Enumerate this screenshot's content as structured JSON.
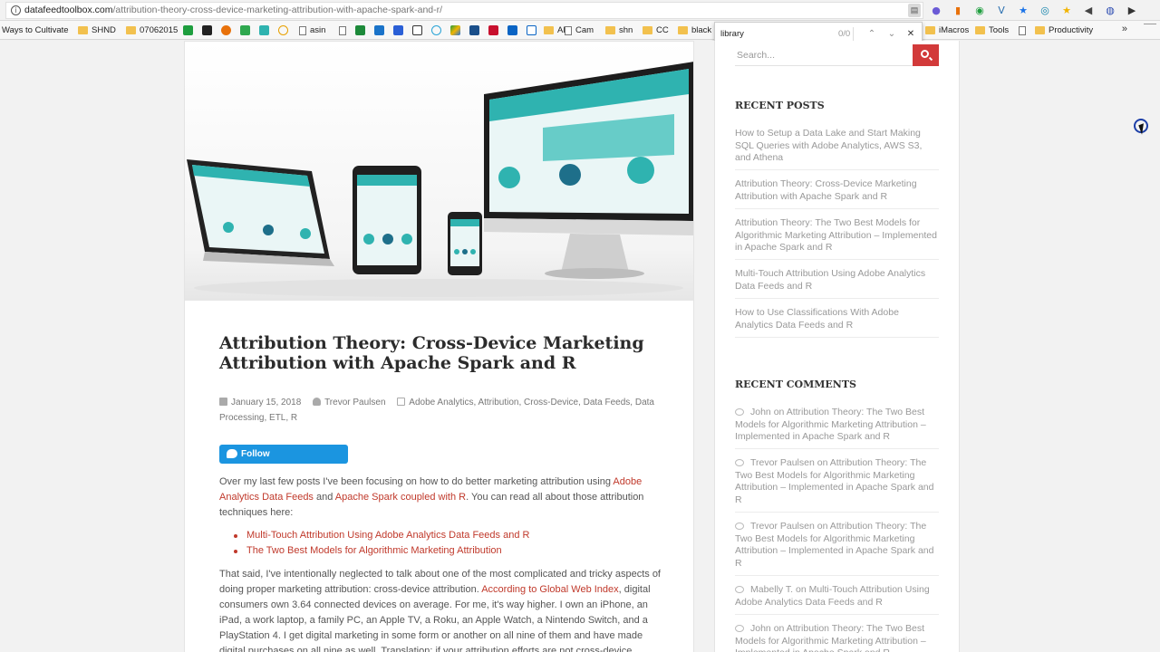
{
  "browser": {
    "url_host": "datafeedtoolbox.com",
    "url_path": "/attribution-theory-cross-device-marketing-attribution-with-apache-spark-and-r/",
    "info_icon": "i",
    "bookmarks": [
      {
        "label": "Ways to Cultivate",
        "icon": "none"
      },
      {
        "label": "SHND",
        "icon": "folder"
      },
      {
        "label": "07062015",
        "icon": "folder"
      },
      {
        "label": "",
        "icon": "green-a"
      },
      {
        "label": "",
        "icon": "amazon-a"
      },
      {
        "label": "",
        "icon": "orange-gear"
      },
      {
        "label": "",
        "icon": "green-arrows"
      },
      {
        "label": "",
        "icon": "teal-swirl"
      },
      {
        "label": "",
        "icon": "orange-hex"
      },
      {
        "label": "asin",
        "icon": "doc"
      },
      {
        "label": "",
        "icon": "doc"
      },
      {
        "label": "",
        "icon": "green-x"
      },
      {
        "label": "",
        "icon": "blue-n"
      },
      {
        "label": "",
        "icon": "blue-a"
      },
      {
        "label": "",
        "icon": "amazon-a"
      },
      {
        "label": "",
        "icon": "circle"
      },
      {
        "label": "",
        "icon": "drive"
      },
      {
        "label": "",
        "icon": "blue-doc"
      },
      {
        "label": "",
        "icon": "red-box"
      },
      {
        "label": "",
        "icon": "outlook"
      },
      {
        "label": "",
        "icon": "calendar"
      },
      {
        "label": "AD",
        "icon": "folder"
      },
      {
        "label": "Cam",
        "icon": "doc"
      },
      {
        "label": "shn",
        "icon": "folder"
      },
      {
        "label": "CC",
        "icon": "folder"
      },
      {
        "label": "black",
        "icon": "folder"
      },
      {
        "label": "iMacros",
        "icon": "folder"
      },
      {
        "label": "Tools",
        "icon": "folder"
      },
      {
        "label": "",
        "icon": "doc"
      },
      {
        "label": "Productivity",
        "icon": "folder"
      }
    ],
    "bookmarks_overflow": "»",
    "find": {
      "query": "library",
      "count": "0/0",
      "prev": "⌃",
      "next": "⌄",
      "close": "✕"
    }
  },
  "article": {
    "title": "Attribution Theory: Cross-Device Marketing Attribution with Apache Spark and R",
    "date": "January 15, 2018",
    "author": "Trevor Paulsen",
    "categories_line1": "Adobe Analytics, Attribution, Cross-Device, Data Feeds, Data",
    "categories_line2": "Processing, ETL, R",
    "follow_button": "Follow @TrevorHPaulsen",
    "p1_a": "Over my last few posts I've been focusing on how to do better marketing attribution using ",
    "p1_link1": "Adobe Analytics Data Feeds",
    "p1_b": " and ",
    "p1_link2": "Apache Spark coupled with R",
    "p1_c": ". You can read all about those attribution techniques here:",
    "bullet1": "Multi-Touch Attribution Using Adobe Analytics Data Feeds and R",
    "bullet2": "The Two Best Models for Algorithmic Marketing Attribution",
    "p2_a": "That said, I've intentionally neglected to talk about one of the most complicated and tricky aspects of doing proper marketing attribution: cross-device attribution. ",
    "p2_link": "According to Global Web Index",
    "p2_b": ", digital consumers own 3.64 connected devices on average. For me, it's way higher. I own an iPhone, an iPad, a work laptop, a family PC, an Apple TV, a Roku, an Apple Watch, a Nintendo Switch, and a PlayStation 4. I get digital marketing in some form or another on all nine of them and have made digital purchases on all nine as well. Translation: if your attribution efforts are not cross-device"
  },
  "sidebar": {
    "search_placeholder": "Search...",
    "recent_posts_title": "RECENT POSTS",
    "recent_posts": [
      "How to Setup a Data Lake and Start Making SQL Queries with Adobe Analytics, AWS S3, and Athena",
      "Attribution Theory: Cross-Device Marketing Attribution with Apache Spark and R",
      "Attribution Theory: The Two Best Models for Algorithmic Marketing Attribution – Implemented in Apache Spark and R",
      "Multi-Touch Attribution Using Adobe Analytics Data Feeds and R",
      "How to Use Classifications With Adobe Analytics Data Feeds and R"
    ],
    "recent_comments_title": "RECENT COMMENTS",
    "recent_comments": [
      {
        "author": "John",
        "on": " on ",
        "post": "Attribution Theory: The Two Best Models for Algorithmic Marketing Attribution – Implemented in Apache Spark and R"
      },
      {
        "author": "Trevor Paulsen",
        "on": " on ",
        "post": "Attribution Theory: The Two Best Models for Algorithmic Marketing Attribution – Implemented in Apache Spark and R"
      },
      {
        "author": "Trevor Paulsen",
        "on": " on ",
        "post": "Attribution Theory: The Two Best Models for Algorithmic Marketing Attribution – Implemented in Apache Spark and R"
      },
      {
        "author": "Mabelly T.",
        "on": " on ",
        "post": "Multi-Touch Attribution Using Adobe Analytics Data Feeds and R"
      },
      {
        "author": "John",
        "on": " on ",
        "post": "Attribution Theory: The Two Best Models for Algorithmic Marketing Attribution – Implemented in Apache Spark and R"
      }
    ]
  },
  "colors": {
    "accent_red": "#d23a3a",
    "link_red": "#c0392b",
    "twitter_blue": "#1b95e0",
    "teal_screen": "#2fb3b0"
  }
}
